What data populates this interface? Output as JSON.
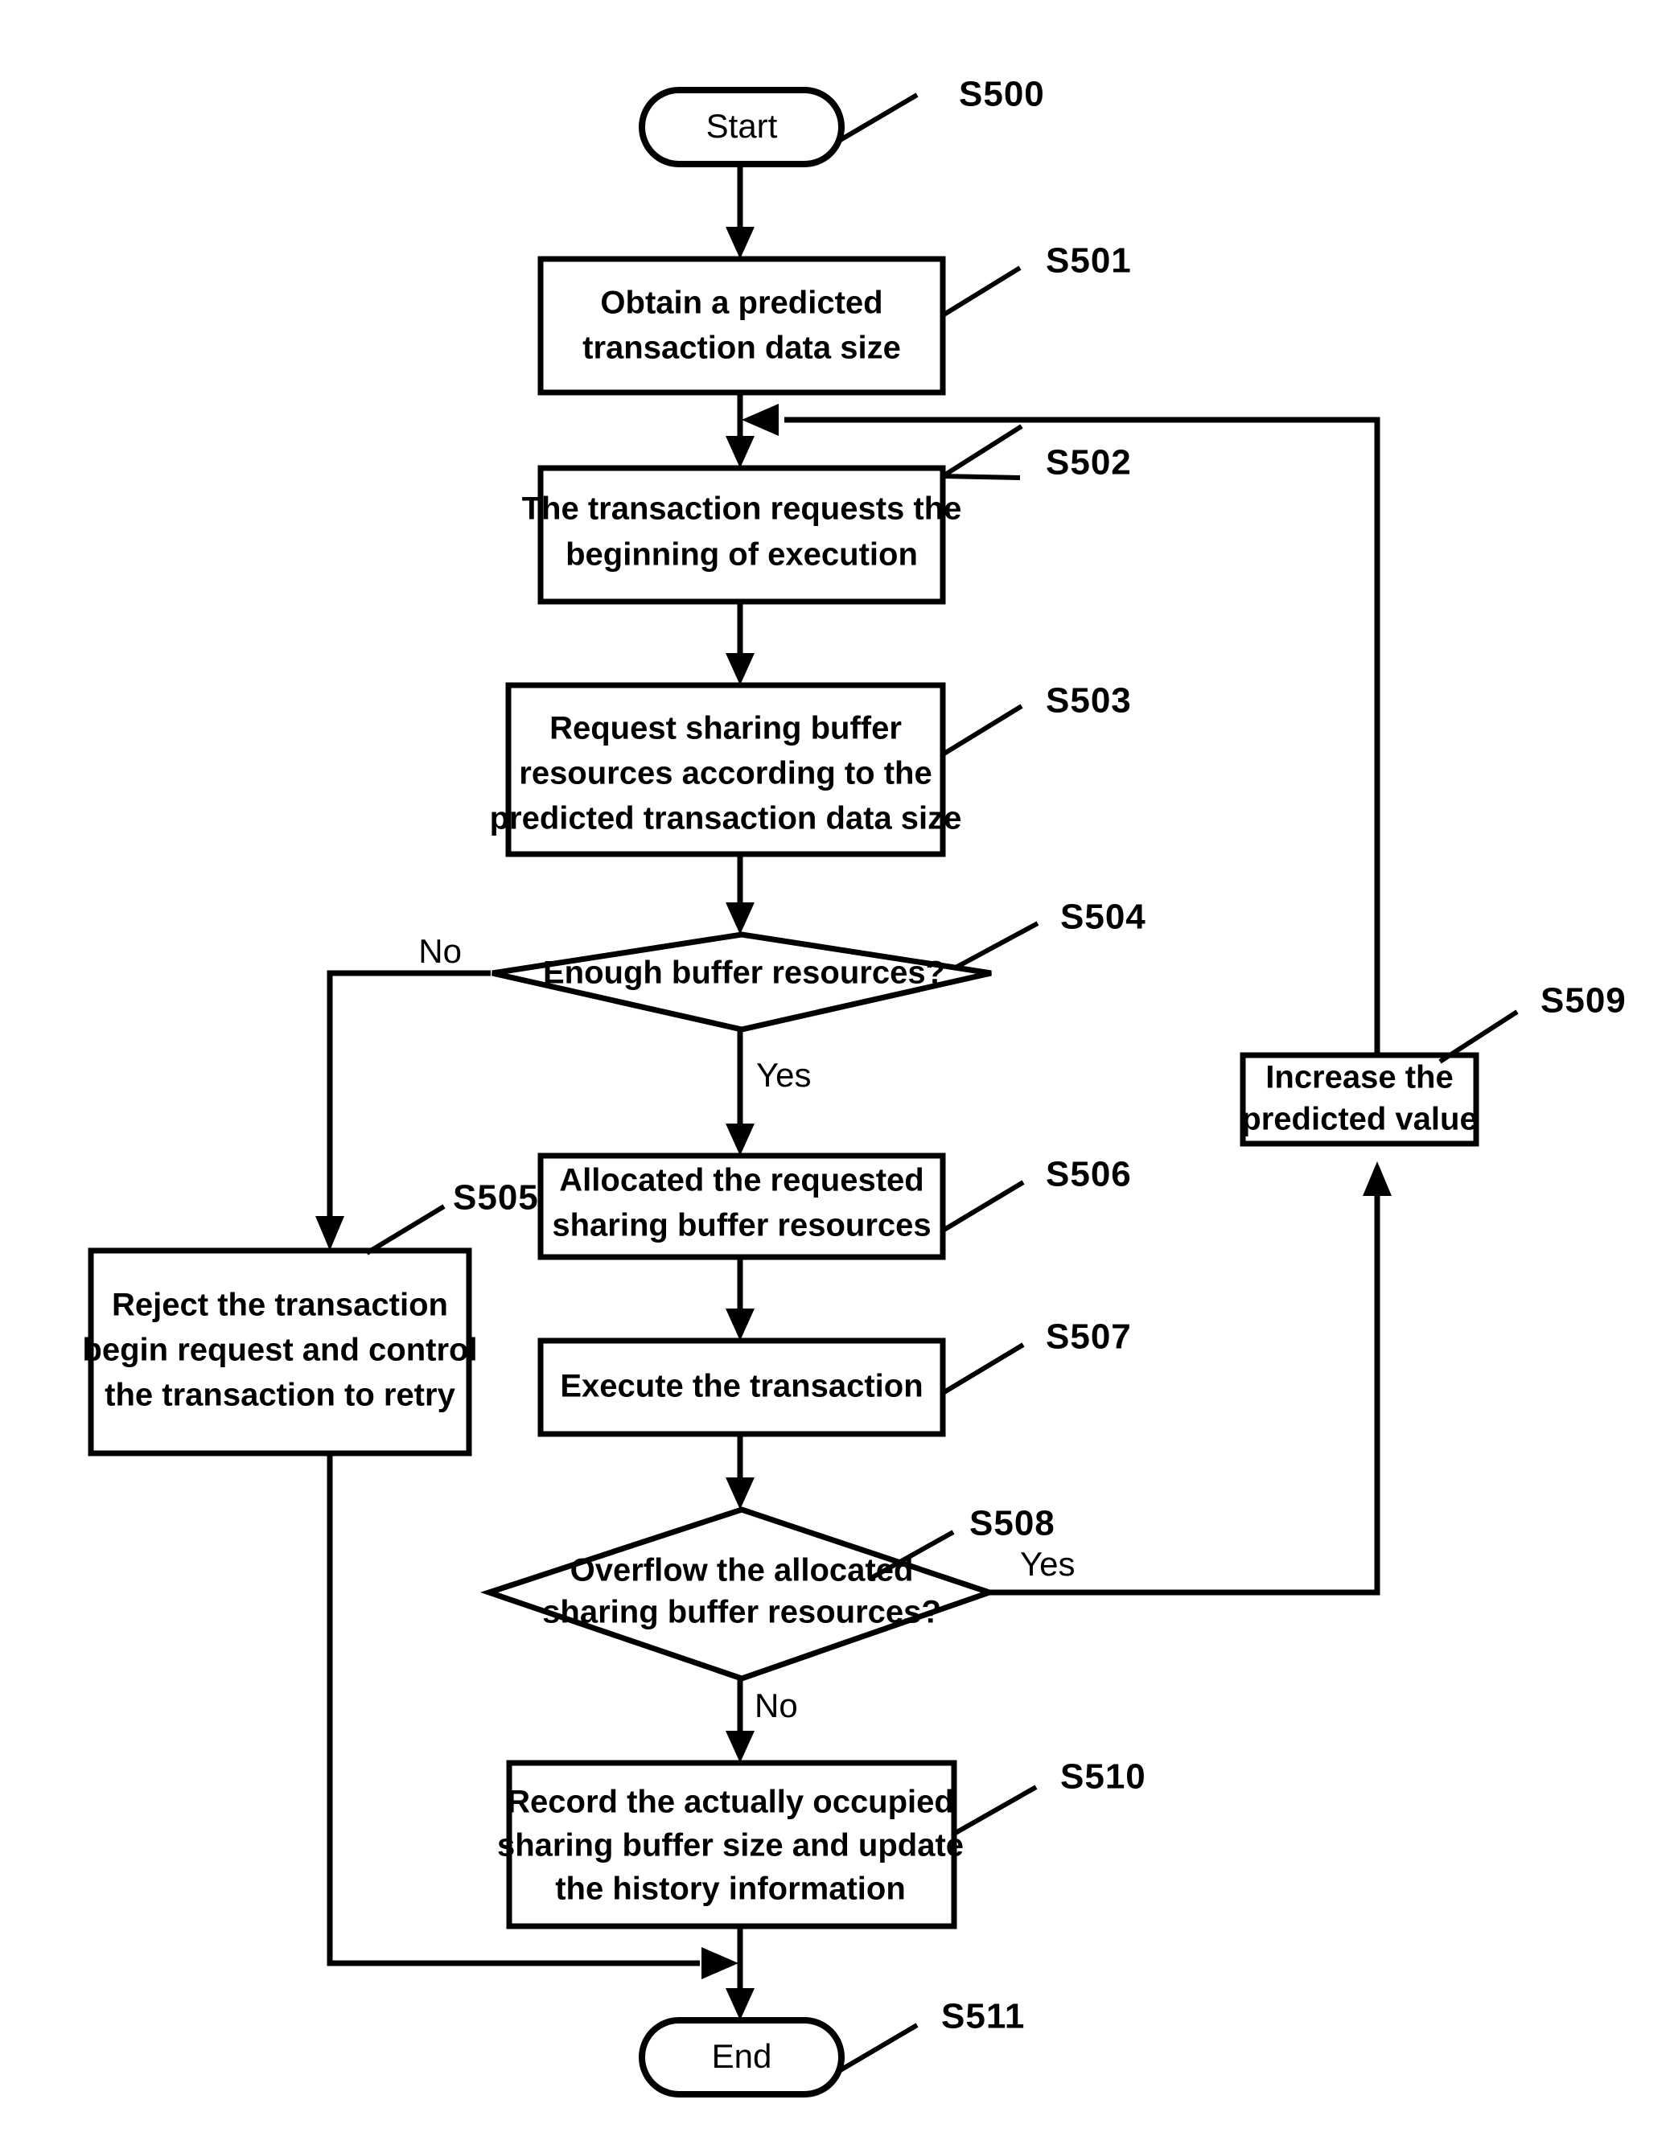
{
  "diagram": {
    "title": "Transaction sharing buffer allocation flowchart",
    "background_color": "#ffffff",
    "line_color": "#000000"
  },
  "nodes": {
    "start": {
      "type": "terminator",
      "label": "Start",
      "ref": "S500"
    },
    "s501": {
      "type": "process",
      "line1": "Obtain a predicted",
      "line2": "transaction data size",
      "ref": "S501"
    },
    "s502": {
      "type": "process",
      "line1": "The transaction requests the",
      "line2": "beginning of execution",
      "ref": "S502"
    },
    "s503": {
      "type": "process",
      "line1": "Request sharing buffer",
      "line2": "resources according to the",
      "line3": "predicted transaction data size",
      "ref": "S503"
    },
    "s504": {
      "type": "decision",
      "line1": "Enough buffer resources?",
      "ref": "S504"
    },
    "s505": {
      "type": "process",
      "line1": "Reject the transaction",
      "line2": "begin request and control",
      "line3": "the transaction to retry",
      "ref": "S505"
    },
    "s506": {
      "type": "process",
      "line1": "Allocated the requested",
      "line2": "sharing buffer resources",
      "ref": "S506"
    },
    "s507": {
      "type": "process",
      "line1": "Execute the transaction",
      "ref": "S507"
    },
    "s508": {
      "type": "decision",
      "line1": "Overflow the allocated",
      "line2": "sharing buffer resources?",
      "ref": "S508"
    },
    "s509": {
      "type": "process",
      "line1": "Increase the",
      "line2": "predicted value",
      "ref": "S509"
    },
    "s510": {
      "type": "process",
      "line1": "Record the actually occupied",
      "line2": "sharing buffer size and update",
      "line3": "the history information",
      "ref": "S510"
    },
    "end": {
      "type": "terminator",
      "label": "End",
      "ref": "S511"
    }
  },
  "branch_labels": {
    "s504_no": "No",
    "s504_yes": "Yes",
    "s508_yes": "Yes",
    "s508_no": "No"
  }
}
